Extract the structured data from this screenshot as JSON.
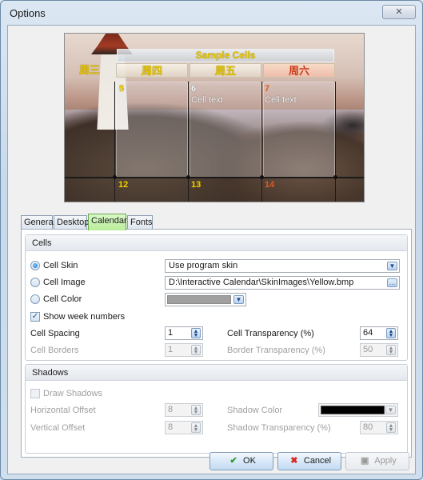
{
  "window": {
    "title": "Options",
    "close_label": "✕"
  },
  "preview": {
    "caption": "Sample Cells",
    "headers": [
      "周三",
      "周四",
      "周五",
      "周六"
    ],
    "cells": {
      "n5": "5",
      "n6": "6",
      "n7": "7",
      "n12": "12",
      "n13": "13",
      "n14": "14",
      "text6": "Cell text",
      "text7": "Cell text"
    }
  },
  "tabs": [
    "General",
    "Desktop",
    "Calendar",
    "Fonts"
  ],
  "active_tab": "Calendar",
  "cells_group": {
    "title": "Cells",
    "cell_skin_label": "Cell Skin",
    "cell_skin_value": "Use program skin",
    "cell_image_label": "Cell Image",
    "cell_image_value": "D:\\Interactive Calendar\\SkinImages\\Yellow.bmp",
    "cell_color_label": "Cell Color",
    "cell_color_value": "#a0a0a0",
    "show_week_numbers_label": "Show week numbers",
    "cell_spacing_label": "Cell Spacing",
    "cell_spacing_value": "1",
    "cell_transparency_label": "Cell Transparency (%)",
    "cell_transparency_value": "64",
    "cell_borders_label": "Cell Borders",
    "cell_borders_value": "1",
    "border_transparency_label": "Border Transparency (%)",
    "border_transparency_value": "50"
  },
  "shadows_group": {
    "title": "Shadows",
    "draw_shadows_label": "Draw Shadows",
    "horizontal_offset_label": "Horizontal Offset",
    "horizontal_offset_value": "8",
    "vertical_offset_label": "Vertical Offset",
    "vertical_offset_value": "8",
    "shadow_color_label": "Shadow Color",
    "shadow_color_value": "#000000",
    "shadow_transparency_label": "Shadow Transparency (%)",
    "shadow_transparency_value": "80"
  },
  "buttons": {
    "ok": "OK",
    "cancel": "Cancel",
    "apply": "Apply"
  },
  "colors": {
    "accent_tab": "#b9ee9a",
    "header_yellow": "#e7c600",
    "saturday_red": "#c93b1a"
  }
}
